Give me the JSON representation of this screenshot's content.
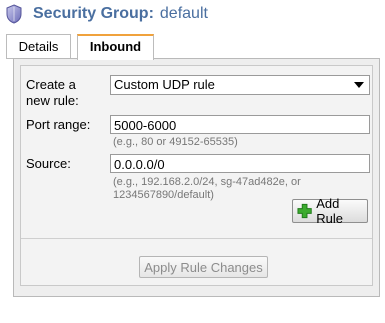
{
  "header": {
    "title_label": "Security Group:",
    "title_value": "default",
    "icon": "shield-icon"
  },
  "tabs": [
    {
      "label": "Details",
      "active": false
    },
    {
      "label": "Inbound",
      "active": true
    }
  ],
  "form": {
    "create_rule_label_line1": "Create a",
    "create_rule_label_line2": "new rule:",
    "rule_type_selected": "Custom UDP rule",
    "port_range_label": "Port range:",
    "port_range_value": "5000-6000",
    "port_range_hint": "(e.g., 80 or 49152-65535)",
    "source_label": "Source:",
    "source_value": "0.0.0.0/0",
    "source_hint_line1": "(e.g., 192.168.2.0/24, sg-47ad482e, or",
    "source_hint_line2": "1234567890/default)",
    "add_rule_label": "Add Rule",
    "add_rule_icon": "plus-icon",
    "apply_label": "Apply Rule Changes",
    "apply_enabled": false
  },
  "colors": {
    "title": "#4a6fa0",
    "active_tab_accent": "#f0a23c",
    "plus_icon": "#3cab2e"
  }
}
